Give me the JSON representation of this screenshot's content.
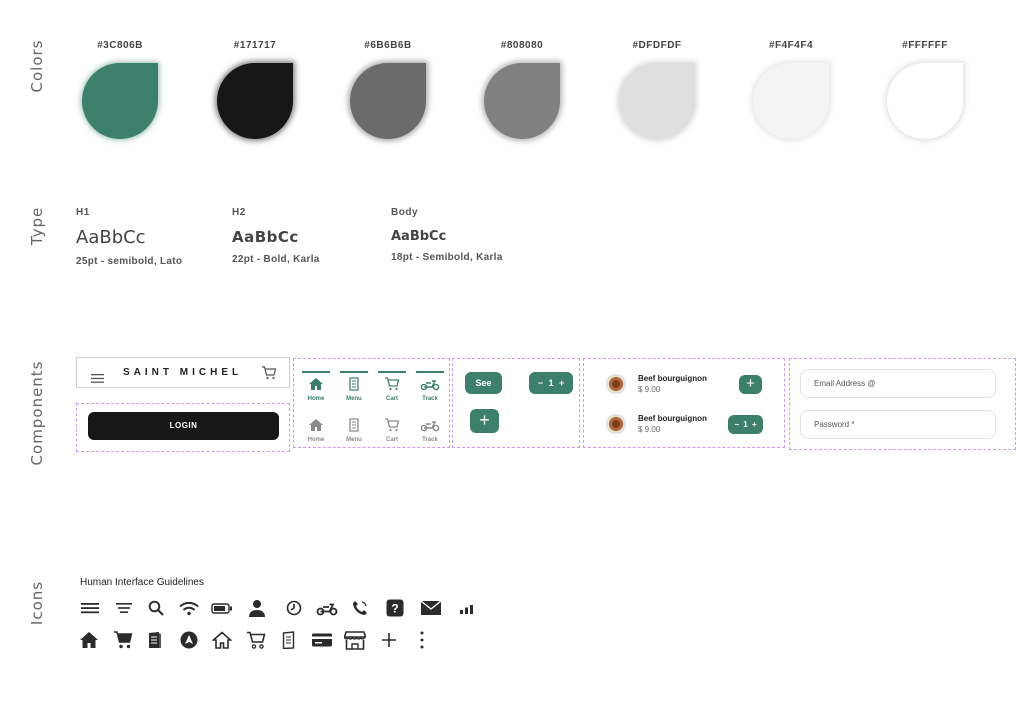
{
  "sections": {
    "colors": "Colors",
    "type": "Type",
    "components": "Components",
    "icons": "Icons"
  },
  "colors": [
    {
      "hex": "#3C806B"
    },
    {
      "hex": "#171717"
    },
    {
      "hex": "#6B6B6B"
    },
    {
      "hex": "#808080"
    },
    {
      "hex": "#DFDFDF"
    },
    {
      "hex": "#F4F4F4"
    },
    {
      "hex": "#FFFFFF"
    }
  ],
  "type": [
    {
      "cap": "H1",
      "sample": "AaBbCc",
      "desc": "25pt - semibold, Lato"
    },
    {
      "cap": "H2",
      "sample": "AaBbCc",
      "desc": "22pt - Bold, Karla"
    },
    {
      "cap": "Body",
      "sample": "AaBbCc",
      "desc": "18pt - Semibold, Karla"
    }
  ],
  "components": {
    "brand": "SAINT MICHEL",
    "login": "LOGIN",
    "tabs": [
      "Home",
      "Menu",
      "Cart",
      "Track"
    ],
    "see": "See",
    "qty": "1",
    "dishes": [
      {
        "name": "Beef bourguignon",
        "price": "$ 9.00"
      },
      {
        "name": "Beef bourguignon",
        "price": "$ 9.00"
      }
    ],
    "email_placeholder": "Email Address @",
    "password_placeholder": "Password *"
  },
  "icons": {
    "title": "Human Interface Guidelines",
    "row1": [
      "menu-icon",
      "filter-icon",
      "search-icon",
      "wifi-icon",
      "battery-icon",
      "user-icon",
      "clock-icon",
      "scooter-icon",
      "phone-icon",
      "help-icon",
      "mail-icon",
      "signal-icon"
    ],
    "row2": [
      "home-filled-icon",
      "cart-filled-icon",
      "menu-book-filled-icon",
      "navigation-icon",
      "home-outline-icon",
      "cart-outline-icon",
      "menu-book-outline-icon",
      "credit-card-icon",
      "store-icon",
      "plus-icon",
      "more-vertical-icon"
    ]
  }
}
